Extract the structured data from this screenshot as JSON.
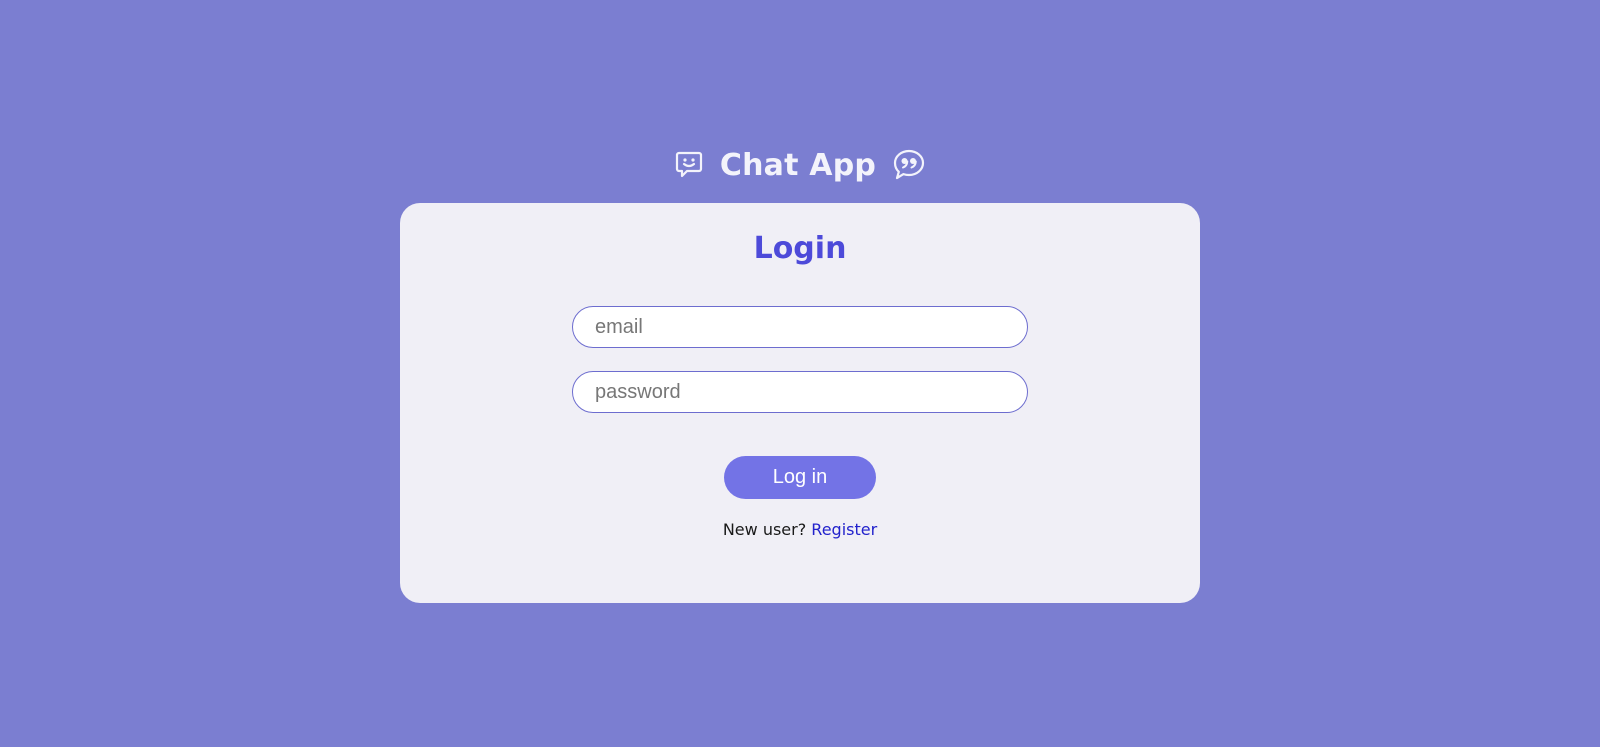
{
  "header": {
    "title": "Chat App",
    "left_icon": "chat-smile-icon",
    "right_icon": "quote-bubble-icon"
  },
  "login_card": {
    "title": "Login",
    "email_placeholder": "email",
    "password_placeholder": "password",
    "login_button": "Log in",
    "register_prompt": "New user?",
    "register_link": "Register"
  },
  "colors": {
    "background": "#7b7ed1",
    "card": "#f0eff6",
    "accent": "#4d4ad9",
    "button": "#7373e6",
    "link": "#2222cc"
  }
}
